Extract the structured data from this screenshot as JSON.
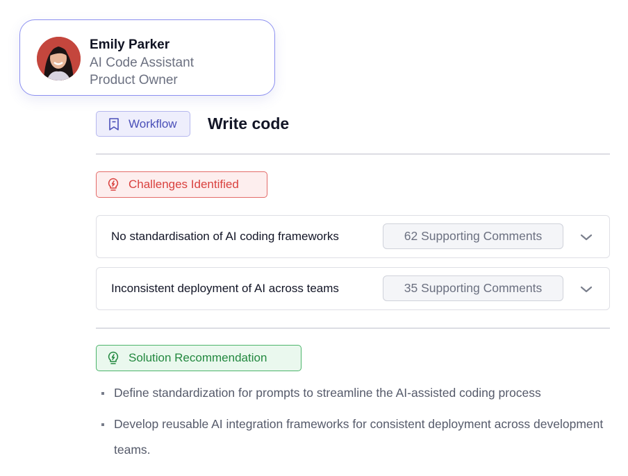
{
  "profile": {
    "name": "Emily Parker",
    "role_line1": "AI Code Assistant",
    "role_line2": "Product Owner"
  },
  "workflow": {
    "tag_label": "Workflow",
    "title": "Write code"
  },
  "challenges": {
    "tag_label": "Challenges Identified",
    "items": [
      {
        "text": "No standardisation of AI coding frameworks",
        "comments": "62 Supporting Comments"
      },
      {
        "text": "Inconsistent deployment of AI across teams",
        "comments": "35 Supporting Comments"
      }
    ]
  },
  "solution": {
    "tag_label": "Solution Recommendation",
    "items": [
      "Define standardization for prompts to streamline the AI-assisted coding process",
      "Develop reusable AI integration frameworks for consistent deployment across development teams."
    ]
  },
  "colors": {
    "profile_border": "#8b8ff0",
    "workflow_accent": "#4a4fb8",
    "challenge_accent": "#d9413e",
    "solution_accent": "#22883f"
  },
  "icons": {
    "workflow": "bookmark-icon",
    "challenge": "lightbulb-icon",
    "solution": "lightbulb-icon",
    "expand": "chevron-down-icon"
  }
}
